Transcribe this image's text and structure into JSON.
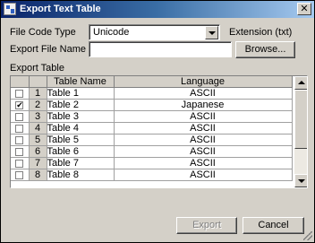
{
  "window": {
    "title": "Export Text Table",
    "close_glyph": "✕"
  },
  "form": {
    "file_code_type_label": "File Code Type",
    "file_code_type_value": "Unicode",
    "extension_label": "Extension (txt)",
    "export_file_name_label": "Export File Name",
    "export_file_name_value": "",
    "browse_label": "Browse...",
    "export_table_label": "Export Table"
  },
  "table": {
    "columns": [
      "",
      "",
      "Table Name",
      "Language"
    ],
    "rows": [
      {
        "checked": false,
        "num": "1",
        "name": "Table 1",
        "language": "ASCII"
      },
      {
        "checked": true,
        "num": "2",
        "name": "Table 2",
        "language": "Japanese"
      },
      {
        "checked": false,
        "num": "3",
        "name": "Table 3",
        "language": "ASCII"
      },
      {
        "checked": false,
        "num": "4",
        "name": "Table 4",
        "language": "ASCII"
      },
      {
        "checked": false,
        "num": "5",
        "name": "Table 5",
        "language": "ASCII"
      },
      {
        "checked": false,
        "num": "6",
        "name": "Table 6",
        "language": "ASCII"
      },
      {
        "checked": false,
        "num": "7",
        "name": "Table 7",
        "language": "ASCII"
      },
      {
        "checked": false,
        "num": "8",
        "name": "Table 8",
        "language": "ASCII"
      }
    ]
  },
  "buttons": {
    "export_label": "Export",
    "export_enabled": false,
    "cancel_label": "Cancel"
  },
  "colors": {
    "titlebar_start": "#0a246a",
    "titlebar_end": "#a6caf0",
    "dialog_face": "#d4d0c8",
    "disabled_text": "#808080"
  }
}
